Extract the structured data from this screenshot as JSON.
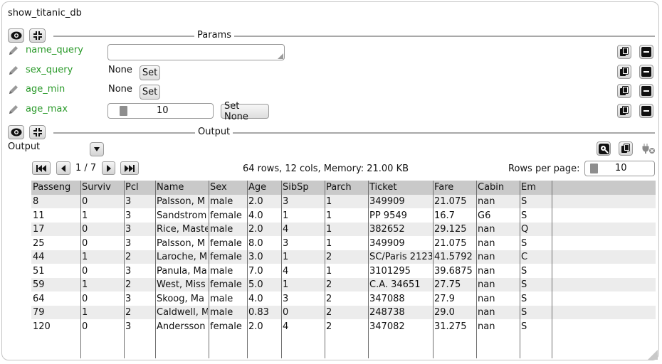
{
  "title": "show_titanic_db",
  "params": {
    "section_label": "Params",
    "rows": [
      {
        "name": "name_query",
        "value": ""
      },
      {
        "name": "sex_query",
        "value": "None",
        "button": "Set"
      },
      {
        "name": "age_min",
        "value": "None",
        "button": "Set"
      },
      {
        "name": "age_max",
        "value": "10",
        "button": "Set None"
      }
    ]
  },
  "output": {
    "section_label": "Output",
    "label": "Output",
    "pager": {
      "text": "1 / 7"
    },
    "summary": "64 rows, 12 cols, Memory: 21.00 KB",
    "rows_per_page_label": "Rows per page:",
    "rows_per_page_value": "10"
  },
  "table": {
    "columns": [
      "Passeng",
      "Surviv",
      "Pcl",
      "Name",
      "Sex",
      "Age",
      "SibSp",
      "Parch",
      "Ticket",
      "Fare",
      "Cabin",
      "Em"
    ],
    "rows": [
      [
        "8",
        "0",
        "3",
        "Palsson, M",
        "male",
        "2.0",
        "3",
        "1",
        "349909",
        "21.075",
        "nan",
        "S"
      ],
      [
        "11",
        "1",
        "3",
        "Sandstrom",
        "female",
        "4.0",
        "1",
        "1",
        "PP 9549",
        "16.7",
        "G6",
        "S"
      ],
      [
        "17",
        "0",
        "3",
        "Rice, Maste",
        "male",
        "2.0",
        "4",
        "1",
        "382652",
        "29.125",
        "nan",
        "Q"
      ],
      [
        "25",
        "0",
        "3",
        "Palsson, M",
        "female",
        "8.0",
        "3",
        "1",
        "349909",
        "21.075",
        "nan",
        "S"
      ],
      [
        "44",
        "1",
        "2",
        "Laroche, M",
        "female",
        "3.0",
        "1",
        "2",
        "SC/Paris 2123",
        "41.5792",
        "nan",
        "C"
      ],
      [
        "51",
        "0",
        "3",
        "Panula, Ma",
        "male",
        "7.0",
        "4",
        "1",
        "3101295",
        "39.6875",
        "nan",
        "S"
      ],
      [
        "59",
        "1",
        "2",
        "West, Miss",
        "female",
        "5.0",
        "1",
        "2",
        "C.A. 34651",
        "27.75",
        "nan",
        "S"
      ],
      [
        "64",
        "0",
        "3",
        "Skoog, Ma",
        "male",
        "4.0",
        "3",
        "2",
        "347088",
        "27.9",
        "nan",
        "S"
      ],
      [
        "79",
        "1",
        "2",
        "Caldwell, M",
        "male",
        "0.83",
        "0",
        "2",
        "248738",
        "29.0",
        "nan",
        "S"
      ],
      [
        "120",
        "0",
        "3",
        "Andersson",
        "female",
        "2.0",
        "4",
        "2",
        "347082",
        "31.275",
        "nan",
        "S"
      ]
    ]
  },
  "colors": {
    "param_name": "#2a9a2a",
    "header_bg": "#c9c9c9",
    "stripe_bg": "#ececec"
  }
}
